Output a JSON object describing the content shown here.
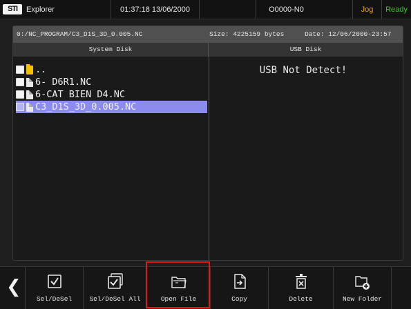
{
  "status_bar": {
    "logo_text": "STI",
    "app_title": "Explorer",
    "clock": "01:37:18 13/06/2000",
    "blank": "",
    "program_no": "O0000-N0",
    "mode": "Jog",
    "state": "Ready",
    "colors": {
      "mode": "#f0a500",
      "state": "#2dcc2d"
    }
  },
  "path_bar": {
    "path": "0:/NC_PROGRAM/C3_D1S_3D_0.005.NC",
    "size": "Size: 4225159 bytes",
    "date": "Date: 12/06/2000-23:57"
  },
  "columns": {
    "system": "System Disk",
    "usb": "USB Disk"
  },
  "files": [
    {
      "name": "..",
      "type": "folder",
      "selected": false
    },
    {
      "name": "6- D6R1.NC",
      "type": "file",
      "selected": false
    },
    {
      "name": "6-CAT BIEN D4.NC",
      "type": "file",
      "selected": false
    },
    {
      "name": "C3_D1S_3D_0.005.NC",
      "type": "file",
      "selected": true
    }
  ],
  "usb_message": "USB Not Detect!",
  "toolbar": {
    "back_icon": "chevron-left-icon",
    "buttons": [
      {
        "label": "Sel/DeSel",
        "icon": "checkbox-icon"
      },
      {
        "label": "Sel/DeSel All",
        "icon": "checkbox-stack-icon"
      },
      {
        "label": "Open File",
        "icon": "open-folder-icon"
      },
      {
        "label": "Copy",
        "icon": "copy-file-icon"
      },
      {
        "label": "Delete",
        "icon": "delete-icon"
      },
      {
        "label": "New Folder",
        "icon": "new-folder-icon"
      }
    ],
    "highlight_color": "#e01818",
    "selected_row_color": "#8c8cf0"
  }
}
